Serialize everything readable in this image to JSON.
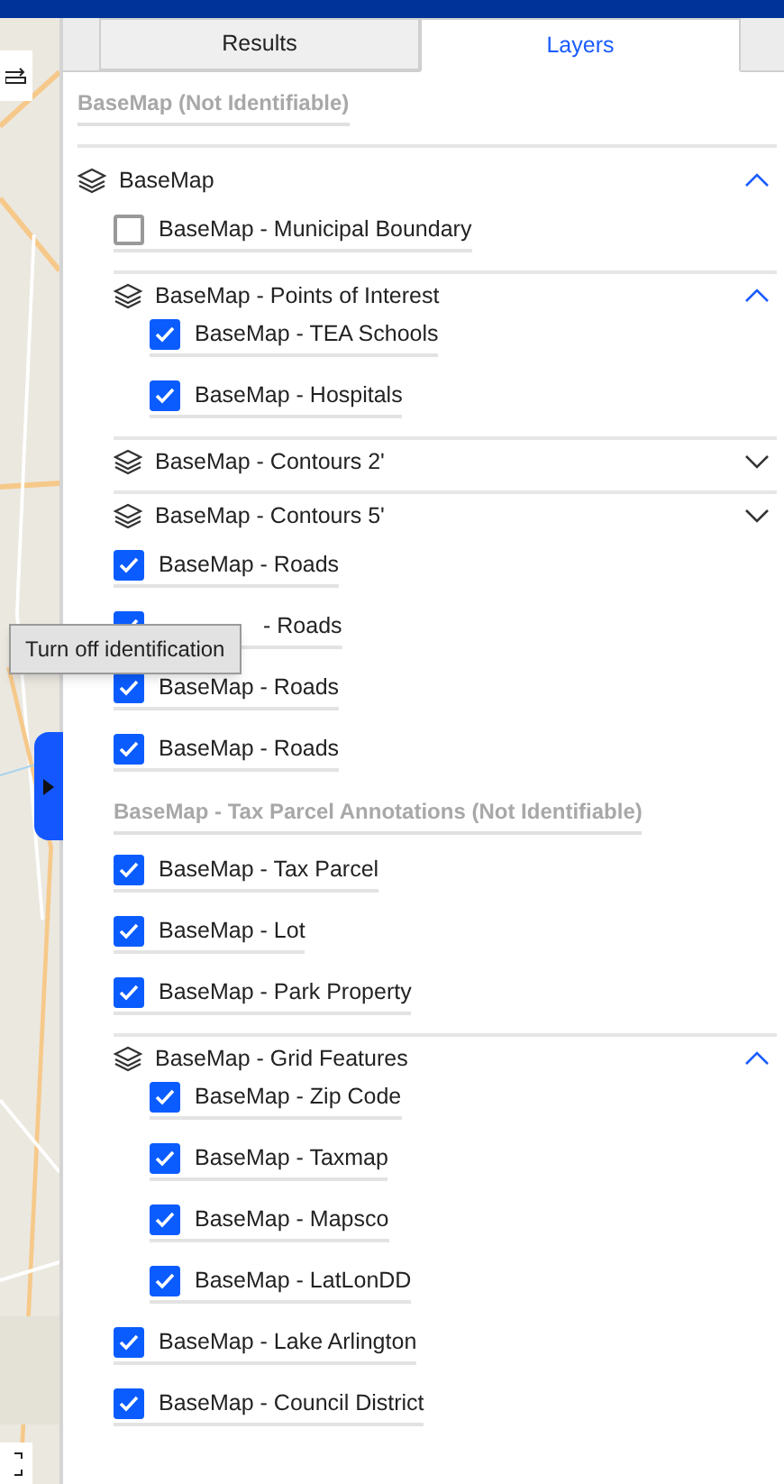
{
  "tabs": [
    {
      "label": "Results",
      "selected": false
    },
    {
      "label": "Layers",
      "selected": true
    }
  ],
  "tooltip": "Turn off identification",
  "layers": [
    {
      "kind": "note",
      "label": "BaseMap (Not Identifiable)"
    },
    {
      "kind": "group",
      "label": "BaseMap",
      "expanded": true,
      "children": [
        {
          "kind": "layer",
          "label": "BaseMap - Municipal Boundary",
          "checked": false
        },
        {
          "kind": "group",
          "label": "BaseMap - Points of Interest",
          "expanded": true,
          "children": [
            {
              "kind": "layer",
              "label": "BaseMap - TEA Schools",
              "checked": true
            },
            {
              "kind": "layer",
              "label": "BaseMap - Hospitals",
              "checked": true
            }
          ]
        },
        {
          "kind": "group",
          "label": "BaseMap - Contours 2'",
          "expanded": false
        },
        {
          "kind": "group",
          "label": "BaseMap - Contours 5'",
          "expanded": false
        },
        {
          "kind": "layer",
          "label": "BaseMap - Roads",
          "checked": true
        },
        {
          "kind": "layer",
          "label": "- Roads",
          "checked": true,
          "tooltip": true
        },
        {
          "kind": "layer",
          "label": "BaseMap - Roads",
          "checked": true
        },
        {
          "kind": "layer",
          "label": "BaseMap - Roads",
          "checked": true
        },
        {
          "kind": "note",
          "label": "BaseMap - Tax Parcel Annotations (Not Identifiable)"
        },
        {
          "kind": "layer",
          "label": "BaseMap - Tax Parcel",
          "checked": true
        },
        {
          "kind": "layer",
          "label": "BaseMap - Lot",
          "checked": true
        },
        {
          "kind": "layer",
          "label": "BaseMap - Park Property",
          "checked": true
        },
        {
          "kind": "group",
          "label": "BaseMap - Grid Features",
          "expanded": true,
          "children": [
            {
              "kind": "layer",
              "label": "BaseMap - Zip Code",
              "checked": true
            },
            {
              "kind": "layer",
              "label": "BaseMap - Taxmap",
              "checked": true
            },
            {
              "kind": "layer",
              "label": "BaseMap - Mapsco",
              "checked": true
            },
            {
              "kind": "layer",
              "label": "BaseMap - LatLonDD",
              "checked": true
            }
          ]
        },
        {
          "kind": "layer",
          "label": "BaseMap - Lake Arlington",
          "checked": true
        },
        {
          "kind": "layer",
          "label": "BaseMap - Council District",
          "checked": true
        }
      ]
    }
  ]
}
